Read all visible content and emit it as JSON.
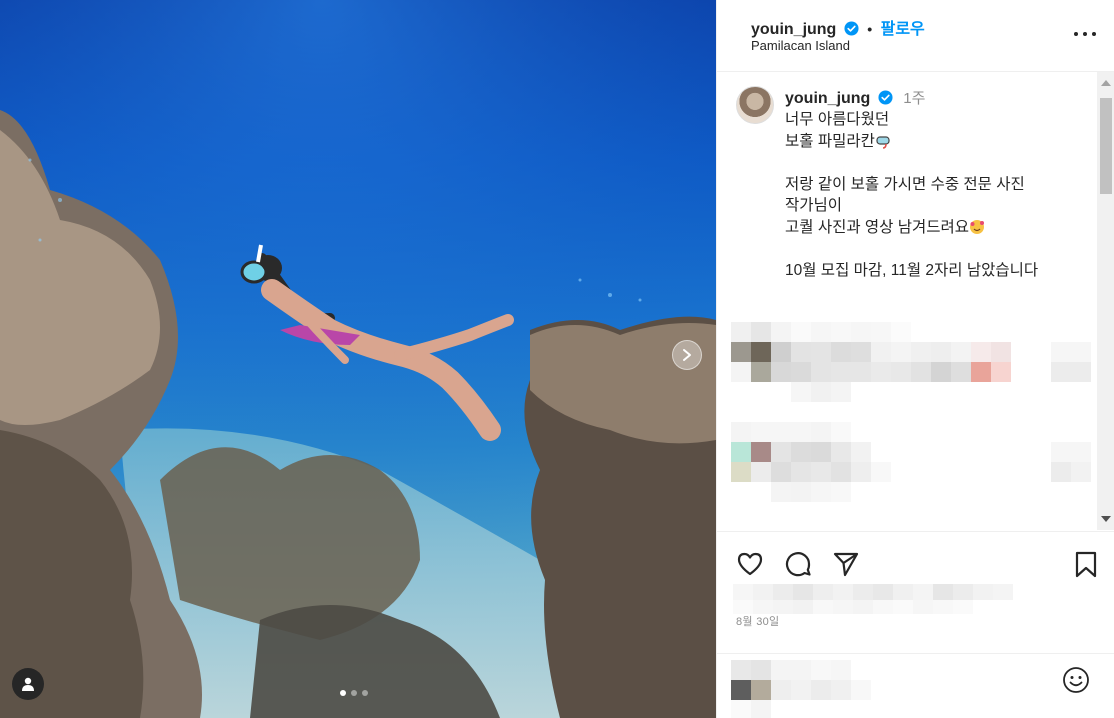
{
  "post": {
    "username": "youin_jung",
    "follow_label": "팔로우",
    "separator": "•",
    "location": "Pamilacan Island",
    "date": "8월 30일"
  },
  "caption": {
    "username": "youin_jung",
    "time": "1주",
    "line1": "너무 아름다웠던",
    "line2": "보홀 파밀라칸",
    "line3": "저랑 같이 보홀 가시면 수중 전문 사진",
    "line4": "작가님이",
    "line5": "고퀄 사진과 영상 남겨드려요",
    "line6": "10월 모집 마감, 11월 2자리 남았습니다"
  },
  "carousel": {
    "total_slides": 3,
    "active_index": 0
  },
  "icons": {
    "verified": "verified-badge-icon",
    "more": "more-options-icon",
    "next": "chevron-right-icon",
    "tag": "user-tag-icon",
    "like": "heart-icon",
    "comment": "comment-icon",
    "share": "paper-plane-icon",
    "save": "bookmark-icon",
    "emoji": "smiley-icon"
  },
  "colors": {
    "accent": "#0095f6",
    "verified": "#0095f6",
    "text": "#262626",
    "muted": "#8e8e8e"
  }
}
